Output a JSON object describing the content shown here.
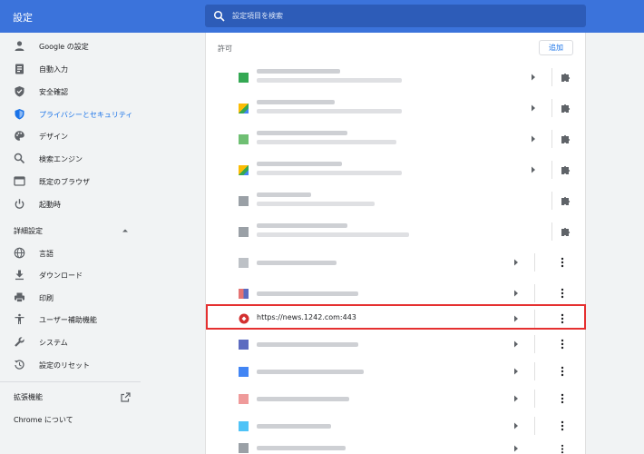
{
  "header": {
    "title": "設定",
    "search_placeholder": "設定項目を検索"
  },
  "sidebar": {
    "items": [
      {
        "label": "Google の設定",
        "icon": "person-icon"
      },
      {
        "label": "自動入力",
        "icon": "clipboard-icon"
      },
      {
        "label": "安全確認",
        "icon": "shield-check-icon"
      },
      {
        "label": "プライバシーとセキュリティ",
        "icon": "shield-icon",
        "active": true
      },
      {
        "label": "デザイン",
        "icon": "palette-icon"
      },
      {
        "label": "検索エンジン",
        "icon": "search-icon"
      },
      {
        "label": "既定のブラウザ",
        "icon": "browser-icon"
      },
      {
        "label": "起動時",
        "icon": "power-icon"
      }
    ],
    "advanced_title": "詳細設定",
    "advanced_items": [
      {
        "label": "言語",
        "icon": "globe-icon"
      },
      {
        "label": "ダウンロード",
        "icon": "download-icon"
      },
      {
        "label": "印刷",
        "icon": "printer-icon"
      },
      {
        "label": "ユーザー補助機能",
        "icon": "accessibility-icon"
      },
      {
        "label": "システム",
        "icon": "wrench-icon"
      },
      {
        "label": "設定のリセット",
        "icon": "reset-icon"
      }
    ],
    "extensions_label": "拡張機能",
    "about_label": "Chrome について"
  },
  "main": {
    "section_label": "許可",
    "add_button": "追加",
    "highlighted_site": "https://news.1242.com:443",
    "colors": {
      "accent": "#1a73e8",
      "header": "#3b73db",
      "highlight": "#e53030"
    }
  }
}
